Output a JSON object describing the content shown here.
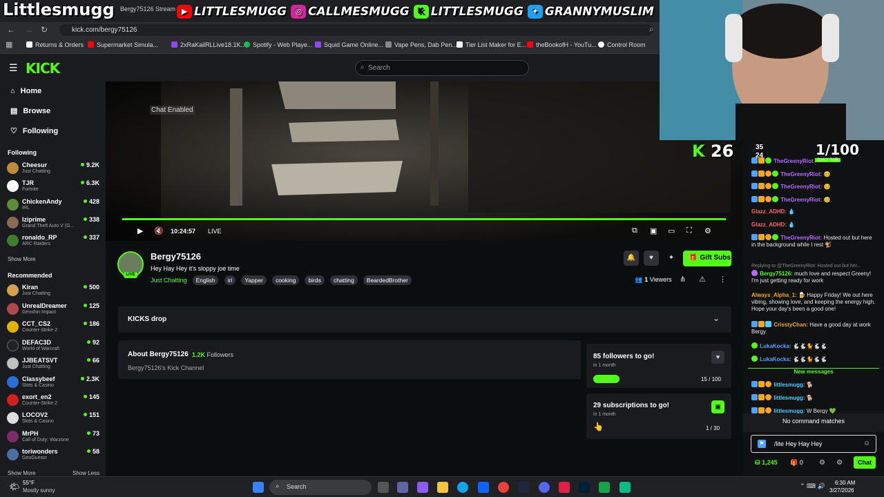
{
  "overlay": {
    "brand": "Littlesmugg",
    "socials": [
      {
        "icon": "youtube-icon",
        "color": "#ff0000",
        "handle": "LITTLESMUGG"
      },
      {
        "icon": "instagram-icon",
        "color": "#d6249f",
        "handle": "CALLMESMUGG"
      },
      {
        "icon": "kick-icon",
        "color": "#53fc18",
        "handle": "LITTLESMUGG"
      },
      {
        "icon": "twitter-icon",
        "color": "#1da1f2",
        "handle": "GRANNYMUSLIM"
      }
    ],
    "tab_title": "Bergy75126 Stream"
  },
  "browser": {
    "url": "kick.com/bergy75126",
    "bookmarks": [
      {
        "label": "Returns & Orders",
        "color": "#ffffff"
      },
      {
        "label": "Supermarket Simula...",
        "color": "#ff0000"
      },
      {
        "label": "2xRaKailRLLive18.1K...",
        "color": "#9146ff"
      },
      {
        "label": "Spotify - Web Playe...",
        "color": "#1db954"
      },
      {
        "label": "Squid Game Online...",
        "color": "#9146ff"
      },
      {
        "label": "Vape Pens, Dab Pen...",
        "color": "#888888"
      },
      {
        "label": "Tier List Maker for E...",
        "color": "#ffffff"
      },
      {
        "label": "theBookofH - YouTu...",
        "color": "#ff0000"
      },
      {
        "label": "Control Room",
        "color": "#ffffff"
      }
    ]
  },
  "header": {
    "logo": "KICK",
    "search_placeholder": "Search"
  },
  "sidebar": {
    "nav": [
      {
        "label": "Home",
        "icon": "home-icon"
      },
      {
        "label": "Browse",
        "icon": "browse-icon"
      },
      {
        "label": "Following",
        "icon": "heart-icon"
      }
    ],
    "following_title": "Following",
    "following": [
      {
        "name": "Cheesur",
        "game": "Just Chatting",
        "viewers": "9.2K",
        "color": "#c08a3e"
      },
      {
        "name": "TJR",
        "game": "Fortnite",
        "viewers": "6.3K",
        "color": "#ffffff"
      },
      {
        "name": "ChickenAndy",
        "game": "IRL",
        "viewers": "428",
        "color": "#5b8c3a"
      },
      {
        "name": "Iziprime",
        "game": "Grand Theft Auto V (G...",
        "viewers": "338",
        "color": "#8a6a50"
      },
      {
        "name": "ronaldo_RP",
        "game": "ARC Raiders",
        "viewers": "337",
        "color": "#3f7d2e"
      }
    ],
    "show_more": "Show More",
    "recommended_title": "Recommended",
    "recommended": [
      {
        "name": "Kiran",
        "game": "Just Chatting",
        "viewers": "500",
        "color": "#d4a24c"
      },
      {
        "name": "UnrealDreamer",
        "game": "Genshin Impact",
        "viewers": "125",
        "color": "#b04a4a"
      },
      {
        "name": "CCT_CS2",
        "game": "Counter-Strike 2",
        "viewers": "186",
        "color": "#e0b000"
      },
      {
        "name": "DEFAC3D",
        "game": "World of Warcraft",
        "viewers": "92",
        "color": "#222222"
      },
      {
        "name": "JJBEATSVT",
        "game": "Just Chatting",
        "viewers": "66",
        "color": "#c0c0c0"
      },
      {
        "name": "Classybeef",
        "game": "Slots & Casino",
        "viewers": "2.3K",
        "color": "#2a6fd6"
      },
      {
        "name": "exort_en2",
        "game": "Counter-Strike 2",
        "viewers": "145",
        "color": "#d02020"
      },
      {
        "name": "LOCOV2",
        "game": "Slots & Casino",
        "viewers": "151",
        "color": "#dddddd"
      },
      {
        "name": "MrPH",
        "game": "Call of Duty: Warzone",
        "viewers": "73",
        "color": "#7a2d6a"
      },
      {
        "name": "toriwonders",
        "game": "GeoGuessr",
        "viewers": "58",
        "color": "#4a6fa0"
      }
    ],
    "show_more_bottom": "Show More",
    "show_less": "Show Less"
  },
  "video": {
    "chat_enabled": "Chat Enabled",
    "time": "10:24:57",
    "live": "LIVE"
  },
  "stream": {
    "live_badge": "LIVE",
    "streamer": "Bergy75126",
    "title": "Hey Hay Hey it's sloppy joe time",
    "category": "Just Chatting",
    "tags": [
      "English",
      "irl",
      "Yapper",
      "cooking",
      "birds",
      "chatting",
      "BeardedBrother"
    ],
    "gift_label": "Gift Subs",
    "viewer_count": "1",
    "viewers_label": "Viewers"
  },
  "kicks_drop": {
    "label": "KICKS drop"
  },
  "about": {
    "title": "About Bergy75126",
    "followers_count": "1.2K",
    "followers_label": "Followers",
    "description": "Bergy75126's Kick Channel"
  },
  "goals": [
    {
      "title": "85 followers to go!",
      "sub": "in 1 month",
      "progress": "15 / 100",
      "fraction": 0.15
    },
    {
      "title": "29 subscriptions to go!",
      "sub": "in 1 month",
      "progress": "1 / 30",
      "fraction": 0.033
    }
  ],
  "overlay_stats": {
    "kick_count": "26",
    "num_a": "35",
    "num_b": "24",
    "sub_goal": "1/100",
    "sub_goal_label": "DAILY SUB"
  },
  "chat": {
    "messages": [
      {
        "user": "TheGreenyRiot",
        "text": "",
        "ucls": "u5"
      },
      {
        "user": "TheGreenyRiot:",
        "text": "😊",
        "ucls": "u5"
      },
      {
        "user": "TheGreenyRiot:",
        "text": "😊",
        "ucls": "u5"
      },
      {
        "user": "TheGreenyRiot:",
        "text": "😊",
        "ucls": "u5"
      },
      {
        "user": "Glazz_ADHD:",
        "text": "💧",
        "ucls": "u4"
      },
      {
        "user": "Glazz_ADHD:",
        "text": "💧",
        "ucls": "u4"
      },
      {
        "user": "TheGreenyRiot:",
        "text": "Hosted out but here in the background while I rest 🐒",
        "ucls": "u5"
      },
      {
        "user": "Bergy75126:",
        "text": "much love and respect Greeny! I'm just getting ready for work",
        "ucls": "u1"
      },
      {
        "user": "Always_Alpha_1:",
        "text": "🍺 Happy Friday! We out here vibing, showing love, and keeping the energy high. Hope your day's been a good one!",
        "ucls": "u2"
      },
      {
        "user": "CrisstyChan:",
        "text": "Have a good day at work Bergy.",
        "ucls": "u2"
      },
      {
        "user": "LukaKocka:",
        "text": "🐇🐇🐈🐇🐇",
        "ucls": "u3"
      },
      {
        "user": "LukaKocka:",
        "text": "🐇🐇🐈🐇🐇",
        "ucls": "u3"
      },
      {
        "user": "littlesmugg:",
        "text": "🐕",
        "ucls": "u6"
      },
      {
        "user": "littlesmugg:",
        "text": "🐕",
        "ucls": "u6"
      },
      {
        "user": "littlesmugg:",
        "text": "W Bergy 💚",
        "ucls": "u6"
      }
    ],
    "replying": "Replying to @TheGreenyRiot: Hosted out but her...",
    "new_messages": "New messages",
    "no_command": "No command matches",
    "input_value": "/lite Hey Hay Hey",
    "points": "1,245",
    "gifts": "0",
    "send_label": "Chat"
  },
  "taskbar": {
    "temp": "55°F",
    "weather": "Mostly sunny",
    "search": "Search",
    "time": "6:30 AM",
    "date": "3/27/2026"
  }
}
